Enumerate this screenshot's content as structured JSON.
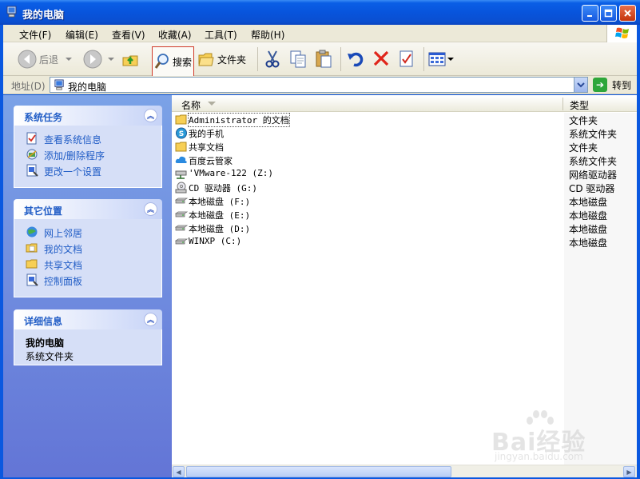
{
  "window": {
    "title": "我的电脑"
  },
  "menu": [
    {
      "label": "文件(F)"
    },
    {
      "label": "编辑(E)"
    },
    {
      "label": "查看(V)"
    },
    {
      "label": "收藏(A)"
    },
    {
      "label": "工具(T)"
    },
    {
      "label": "帮助(H)"
    }
  ],
  "toolbar": {
    "back_label": "后退",
    "search_label": "搜索",
    "folders_label": "文件夹"
  },
  "address": {
    "label": "地址(D)",
    "value": "我的电脑",
    "go_label": "转到"
  },
  "panels": {
    "system_tasks": {
      "title": "系统任务",
      "items": [
        {
          "label": "查看系统信息"
        },
        {
          "label": "添加/删除程序"
        },
        {
          "label": "更改一个设置"
        }
      ]
    },
    "other_places": {
      "title": "其它位置",
      "items": [
        {
          "label": "网上邻居"
        },
        {
          "label": "我的文档"
        },
        {
          "label": "共享文档"
        },
        {
          "label": "控制面板"
        }
      ]
    },
    "details": {
      "title": "详细信息",
      "name": "我的电脑",
      "type": "系统文件夹"
    }
  },
  "list": {
    "columns": {
      "name": "名称",
      "type": "类型"
    },
    "rows": [
      {
        "name": "Administrator 的文档",
        "type": "文件夹",
        "icon": "folder-icon"
      },
      {
        "name": "我的手机",
        "type": "系统文件夹",
        "icon": "phone-icon"
      },
      {
        "name": "共享文档",
        "type": "文件夹",
        "icon": "folder-icon"
      },
      {
        "name": "百度云管家",
        "type": "系统文件夹",
        "icon": "cloud-icon"
      },
      {
        "name": "'VMware-122 (Z:)",
        "type": "网络驱动器",
        "icon": "network-drive-icon"
      },
      {
        "name": "CD 驱动器 (G:)",
        "type": "CD 驱动器",
        "icon": "cd-drive-icon"
      },
      {
        "name": "本地磁盘 (F:)",
        "type": "本地磁盘",
        "icon": "hard-disk-icon"
      },
      {
        "name": "本地磁盘 (E:)",
        "type": "本地磁盘",
        "icon": "hard-disk-icon"
      },
      {
        "name": "本地磁盘 (D:)",
        "type": "本地磁盘",
        "icon": "hard-disk-icon"
      },
      {
        "name": "WINXP (C:)",
        "type": "本地磁盘",
        "icon": "hard-disk-icon"
      }
    ]
  },
  "watermark": {
    "brand": "Bai经验",
    "url": "jingyan.baidu.com"
  }
}
